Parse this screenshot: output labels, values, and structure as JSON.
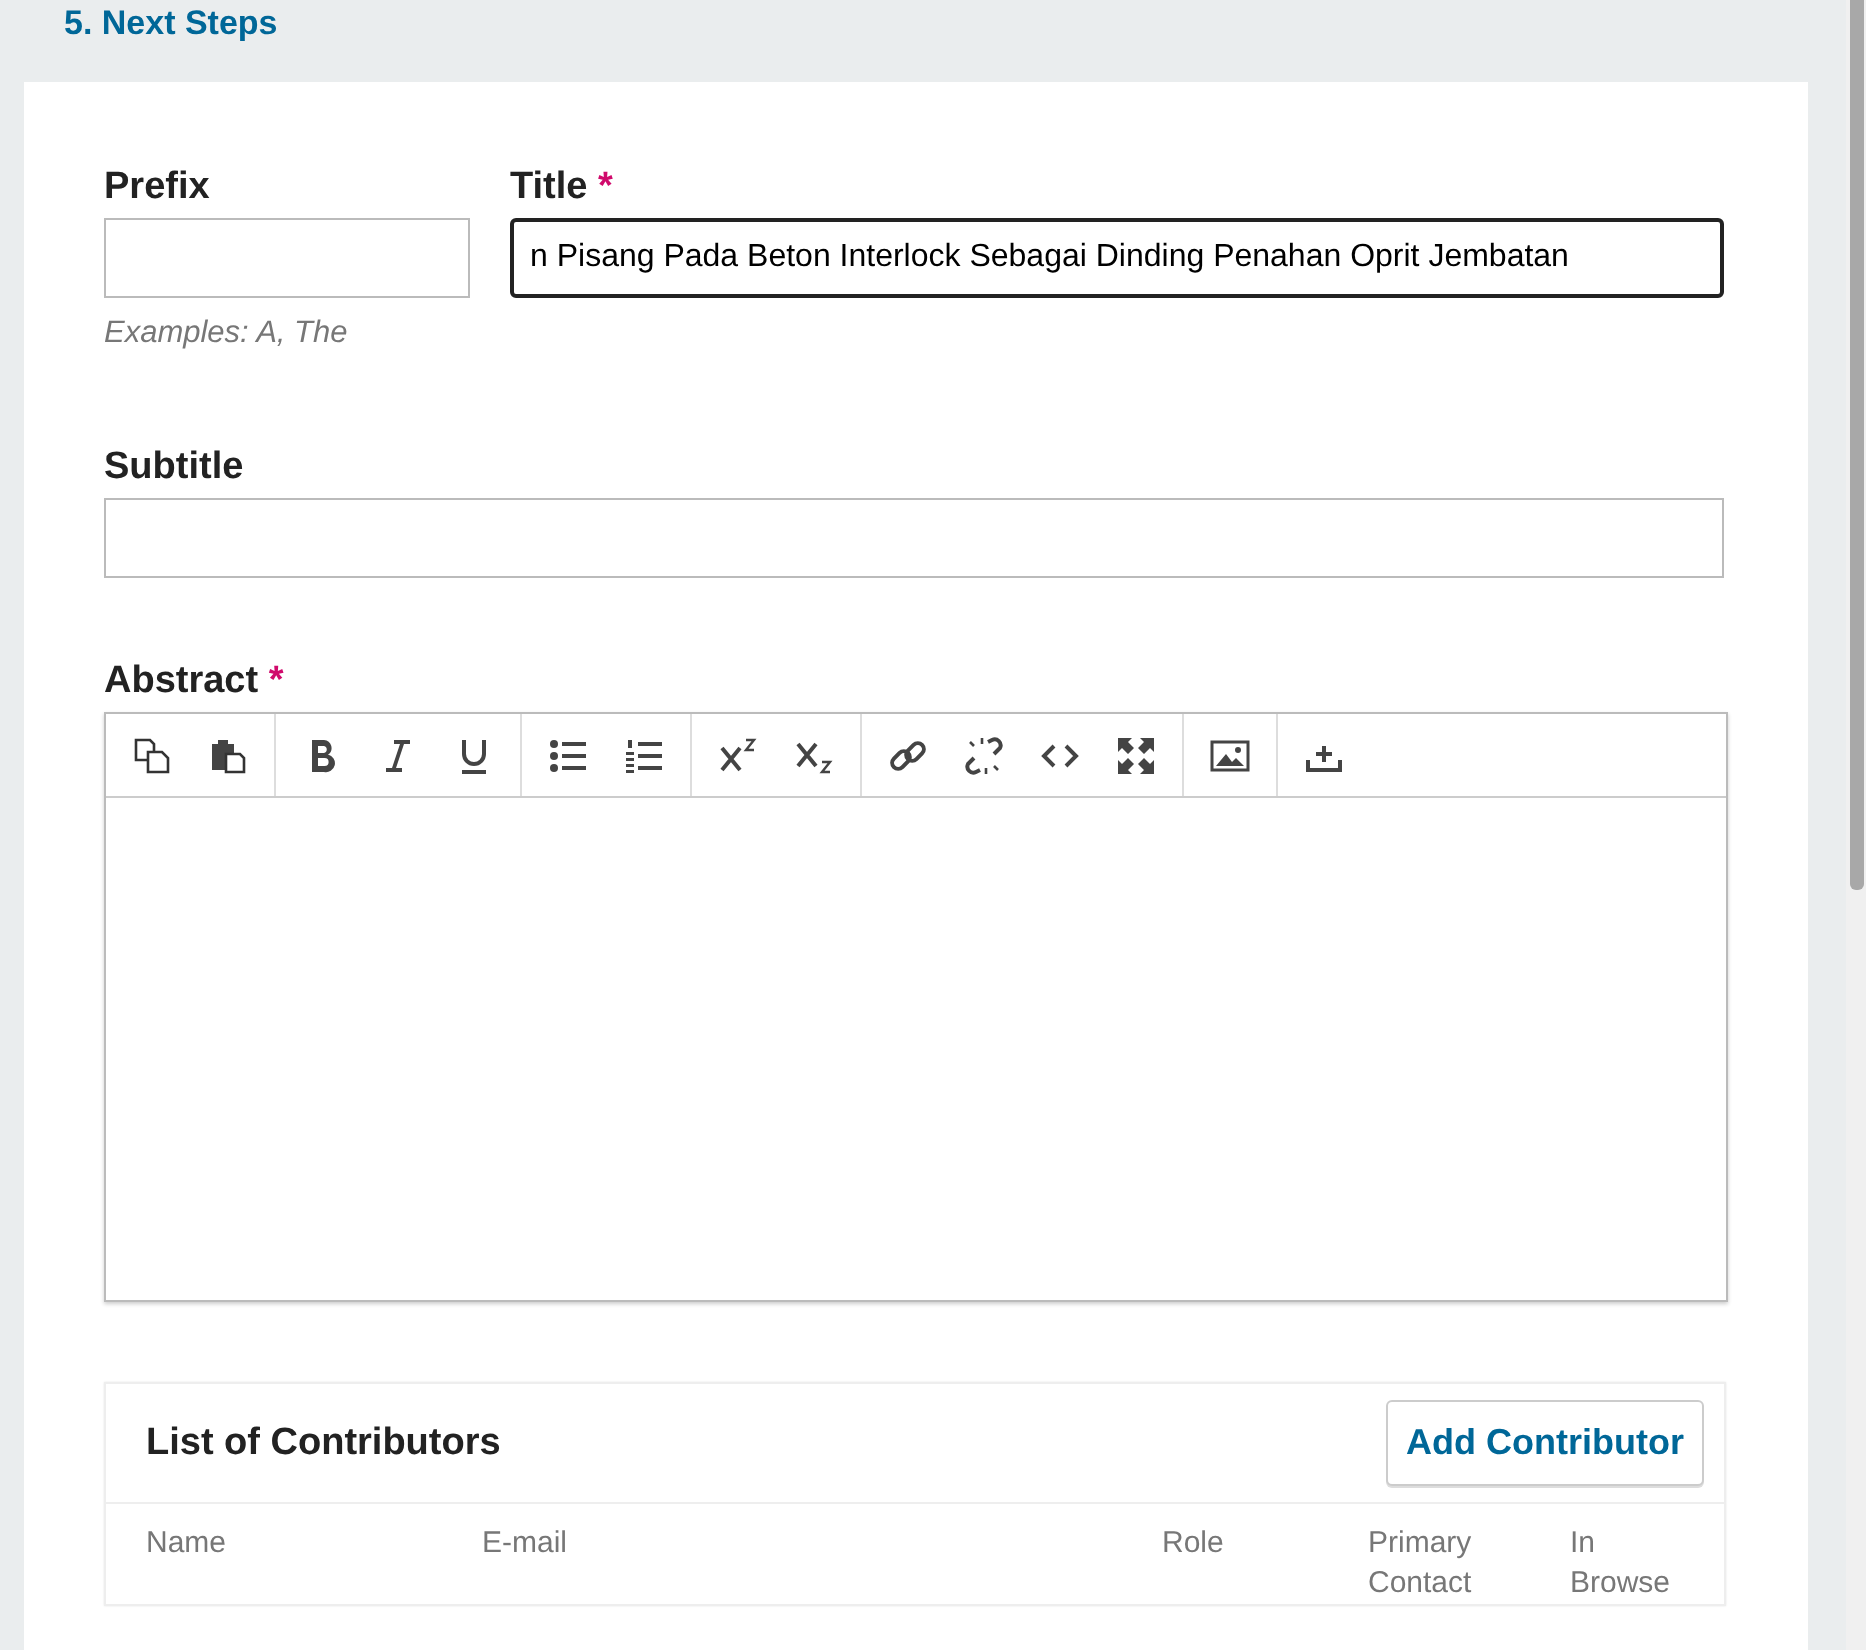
{
  "section_heading": "5. Next Steps",
  "prefix": {
    "label": "Prefix",
    "hint": "Examples: A, The"
  },
  "title": {
    "label": "Title",
    "required_mark": "*",
    "value": "n Pisang Pada Beton Interlock Sebagai Dinding Penahan Oprit Jembatan",
    "focused": true
  },
  "subtitle": {
    "label": "Subtitle"
  },
  "abstract": {
    "label": "Abstract",
    "required_mark": "*"
  },
  "contributors": {
    "title": "List of Contributors",
    "add_button": "Add Contributor",
    "columns": [
      {
        "label": "Name"
      },
      {
        "label": "E-mail"
      },
      {
        "label": "Role"
      },
      {
        "label": "Primary Contact"
      },
      {
        "label": "In Browse"
      }
    ]
  }
}
